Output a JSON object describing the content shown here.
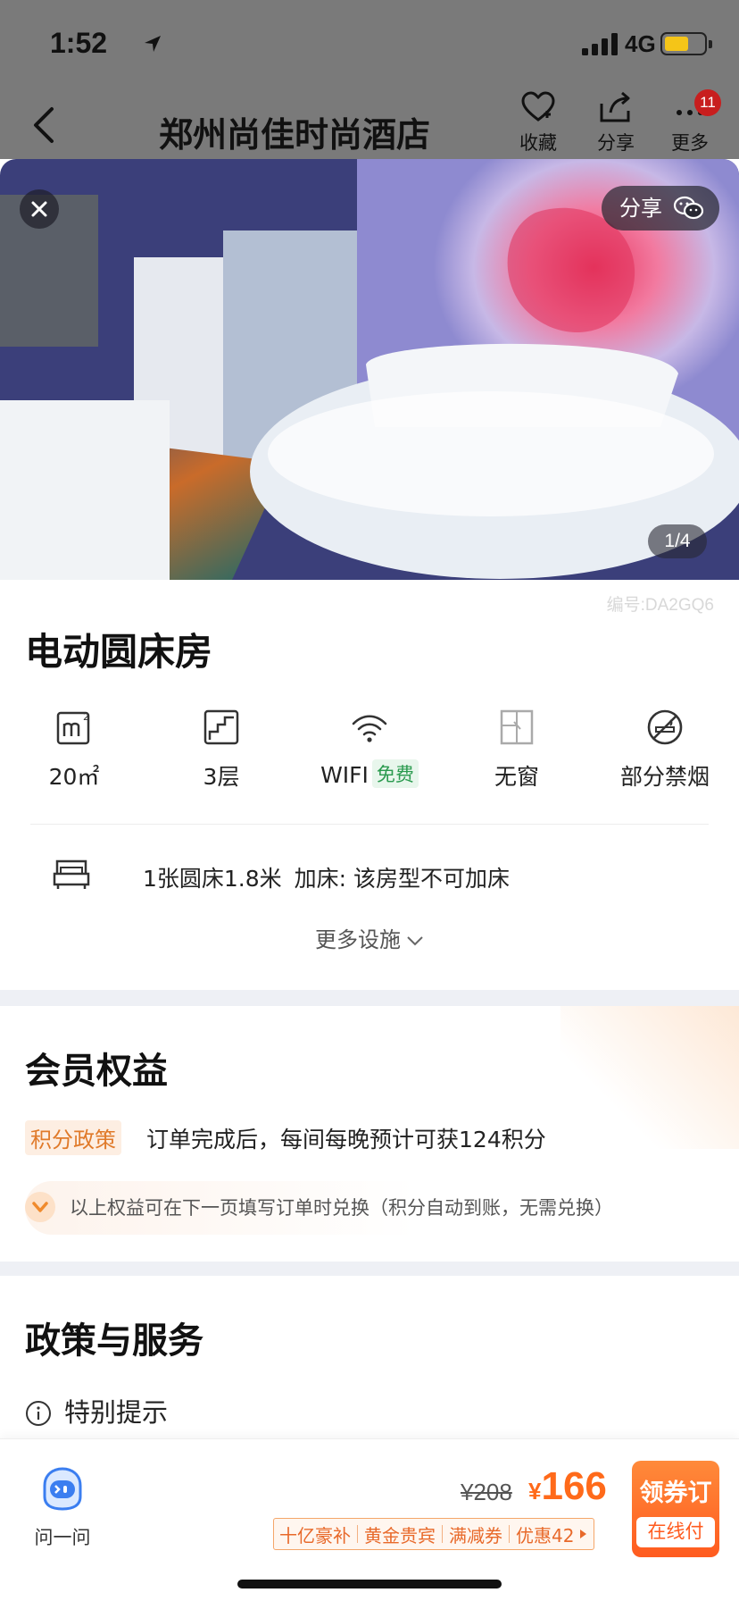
{
  "status_bar": {
    "time": "1:52",
    "network": "4G"
  },
  "nav": {
    "title": "郑州尚佳时尚酒店",
    "favorite_label": "收藏",
    "share_label": "分享",
    "more_label": "更多",
    "badge_count": "11"
  },
  "photo": {
    "share_label": "分享",
    "counter": "1/4"
  },
  "room": {
    "code": "编号:DA2GQ6",
    "title": "电动圆床房",
    "facilities": [
      {
        "icon": "area-icon",
        "label": "20㎡"
      },
      {
        "icon": "floor-icon",
        "label": "3层"
      },
      {
        "icon": "wifi-icon",
        "label": "WIFI",
        "tag": "免费"
      },
      {
        "icon": "window-icon",
        "label": "无窗"
      },
      {
        "icon": "no-smoking-icon",
        "label": "部分禁烟"
      }
    ],
    "bed_info": "1张圆床1.8米",
    "extra_bed": "加床: 该房型不可加床",
    "more_facilities": "更多设施"
  },
  "member": {
    "title": "会员权益",
    "points_tag": "积分政策",
    "points_text": "订单完成后，每间每晚预计可获124积分",
    "hint": "以上权益可在下一页填写订单时兑换（积分自动到账，无需兑换）"
  },
  "policy": {
    "title": "政策与服务",
    "notice": "特别提示"
  },
  "bottom_bar": {
    "ask_label": "问一问",
    "original_price": "¥208",
    "currency": "¥",
    "price": "166",
    "promos": [
      "十亿豪补",
      "黄金贵宾",
      "满减券",
      "优惠42"
    ],
    "book_label": "领券订",
    "pay_label": "在线付"
  },
  "colors": {
    "accent": "#ff6a1a",
    "free_green": "#2a9a4e",
    "page_gap": "#eef0f5"
  }
}
